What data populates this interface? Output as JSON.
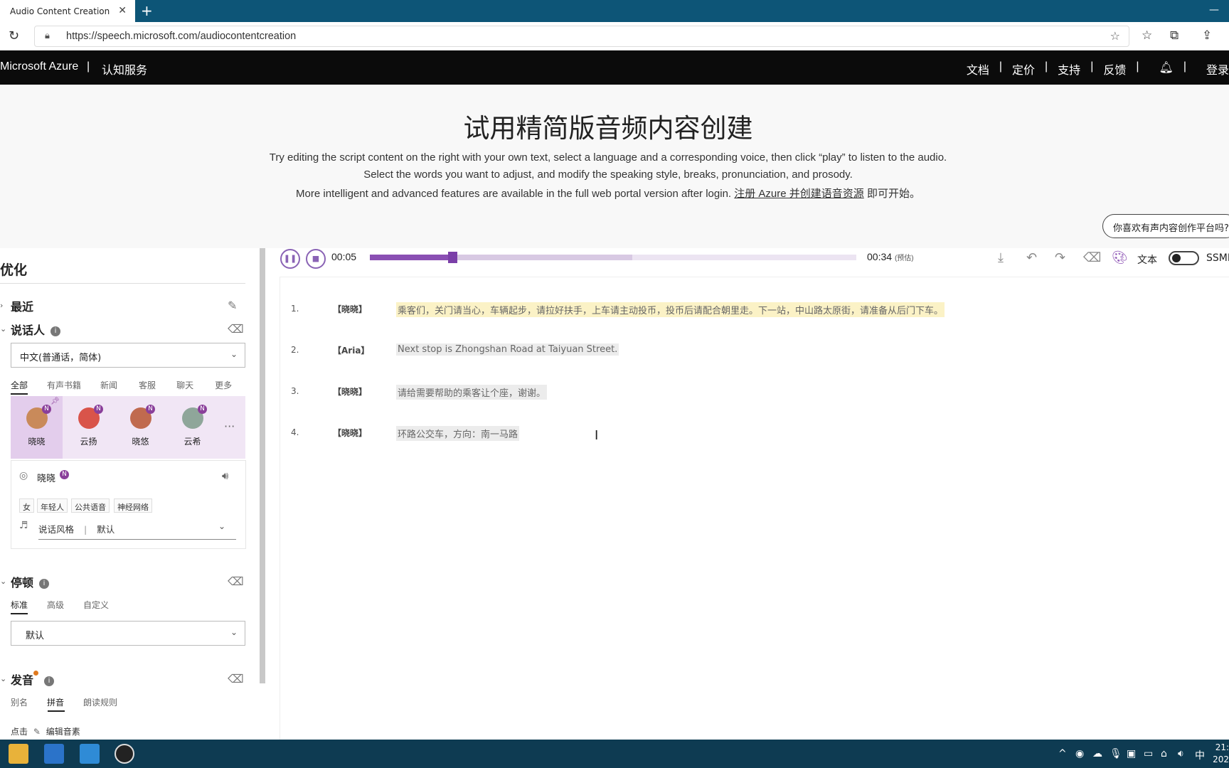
{
  "browser": {
    "tab_title": "Audio Content Creation",
    "url": "https://speech.microsoft.com/audiocontentcreation"
  },
  "topnav": {
    "brand": "Microsoft Azure",
    "separator": "|",
    "service": "认知服务",
    "links": [
      "文档",
      "定价",
      "支持",
      "反馈"
    ],
    "login": "登录"
  },
  "hero": {
    "title": "试用精简版音频内容创建",
    "line1": "Try editing the script content on the right with your own text, select a language and a corresponding voice, then click “play” to listen to the audio.",
    "line2": "Select the words you want to adjust, and modify the speaking style, breaks, pronunciation, and prosody.",
    "line3_prefix": "More intelligent and advanced features are available in the full web portal version after login. ",
    "line3_link": "注册 Azure 并创建语音资源",
    "line3_suffix": " 即可开始。",
    "feedback_pill": "你喜欢有声内容创作平台吗?"
  },
  "sidebar": {
    "title": "优化",
    "recent": "最近",
    "speaker": {
      "heading": "说话人",
      "language": "中文(普通话，简体)",
      "tabs": [
        "全部",
        "有声书籍",
        "新闻",
        "客服",
        "聊天",
        "更多"
      ],
      "voices": [
        {
          "name": "晓晓",
          "badge": "N"
        },
        {
          "name": "云扬",
          "badge": "N"
        },
        {
          "name": "晓悠",
          "badge": "N"
        },
        {
          "name": "云希",
          "badge": "N"
        }
      ],
      "more": "···",
      "selected_voice": "晓晓",
      "selected_badge": "N",
      "tags": [
        "女",
        "年轻人",
        "公共语音",
        "神经网络"
      ],
      "style_label": "说话风格",
      "style_sep": "|",
      "style_value": "默认"
    },
    "pause": {
      "heading": "停顿",
      "tabs": [
        "标准",
        "高级",
        "自定义"
      ],
      "value": "默认"
    },
    "pronunciation": {
      "heading": "发音",
      "tabs": [
        "别名",
        "拼音",
        "朗读规则"
      ],
      "hint_prefix": "点击",
      "hint_action": "编辑音素"
    }
  },
  "player": {
    "current": "00:05",
    "total": "00:34",
    "estimate": "(预估)",
    "progress": 0.17,
    "buffered": 0.54,
    "text_label": "文本",
    "ssml_label": "SSML"
  },
  "script": [
    {
      "num": "1.",
      "speaker": "【晓晓】",
      "text": "乘客们，关门请当心，车辆起步，请拉好扶手，上车请主动投币，投币后请配合朝里走。下一站，中山路太原街，请准备从后门下车。"
    },
    {
      "num": "2.",
      "speaker": "【Aria】",
      "text": "Next stop is Zhongshan Road at Taiyuan Street."
    },
    {
      "num": "3.",
      "speaker": "【晓晓】",
      "text": "请给需要帮助的乘客让个座，谢谢。"
    },
    {
      "num": "4.",
      "speaker": "【晓晓】",
      "text": "环路公交车，方向：南一马路"
    }
  ],
  "taskbar": {
    "tray_lang": "中",
    "clock_time": "21:",
    "clock_date": "202"
  },
  "colors": {
    "accent": "#8a4fb3",
    "tabbar": "#0d5577",
    "azurebar": "#0b0b0b",
    "taskbar": "#0e3b52",
    "highlight": "#fbf2c6"
  }
}
